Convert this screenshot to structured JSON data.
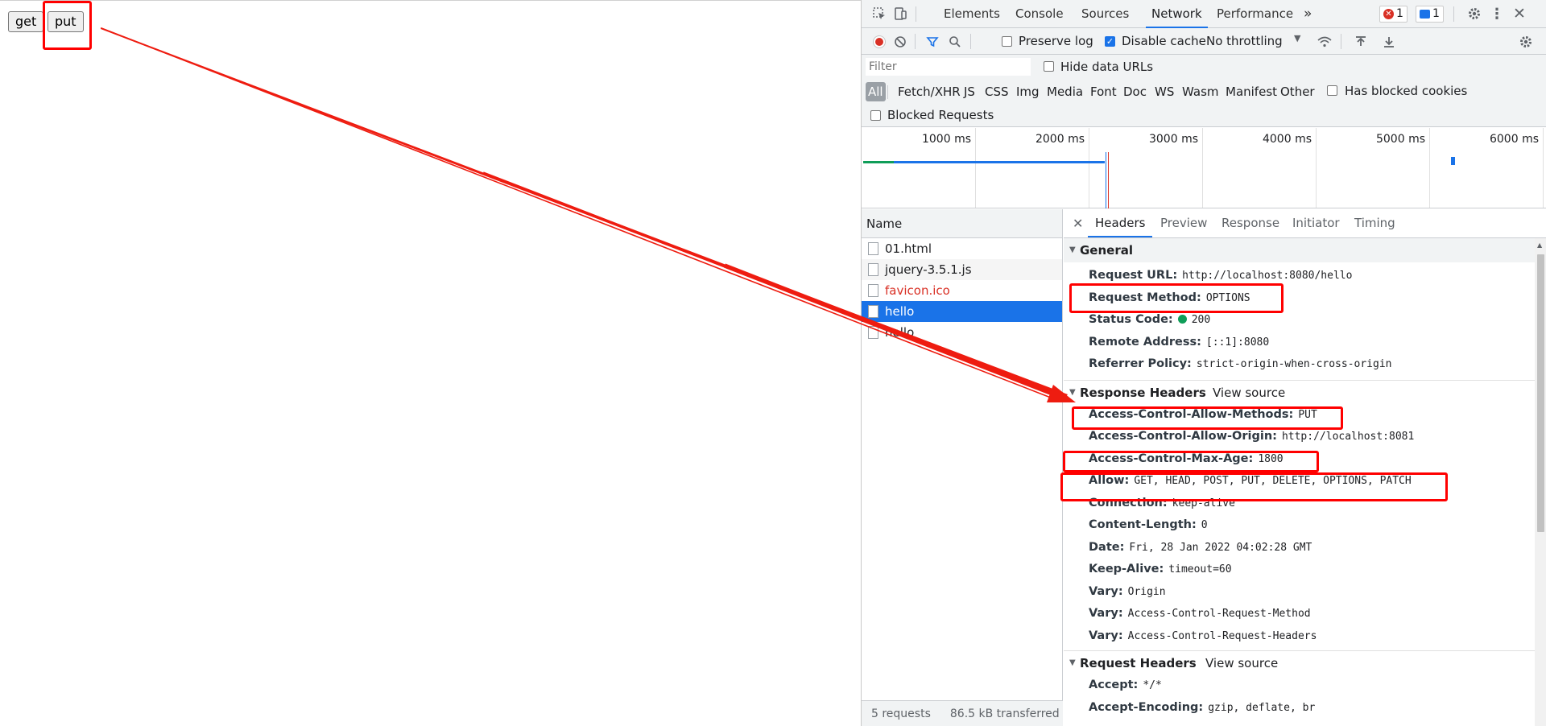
{
  "page": {
    "buttons": {
      "get_label": "get",
      "put_label": "put"
    }
  },
  "devtools": {
    "main_tabs": [
      "Elements",
      "Console",
      "Sources",
      "Network",
      "Performance"
    ],
    "more_tabs_glyph": "»",
    "errors_count": "1",
    "messages_count": "1",
    "icons": [
      "inspect-icon",
      "device-toolbar-icon",
      "settings-icon",
      "more-icon",
      "close-icon"
    ],
    "toolbar": {
      "preserve_log": "Preserve log",
      "disable_cache": "Disable cache",
      "throttling": "No throttling"
    },
    "filter": {
      "placeholder": "Filter",
      "hide_data_urls": "Hide data URLs",
      "types": [
        "All",
        "Fetch/XHR",
        "JS",
        "CSS",
        "Img",
        "Media",
        "Font",
        "Doc",
        "WS",
        "Wasm",
        "Manifest",
        "Other"
      ],
      "has_blocked_cookies": "Has blocked cookies",
      "blocked_requests": "Blocked Requests"
    },
    "overview": {
      "ticks": [
        "1000 ms",
        "2000 ms",
        "3000 ms",
        "4000 ms",
        "5000 ms",
        "6000 ms"
      ]
    },
    "requests": {
      "header": "Name",
      "rows": [
        "01.html",
        "jquery-3.5.1.js",
        "favicon.ico",
        "hello",
        "hello"
      ],
      "status_requests": "5 requests",
      "status_transferred": "86.5 kB transferred"
    },
    "detail_tabs": [
      "Headers",
      "Preview",
      "Response",
      "Initiator",
      "Timing"
    ],
    "general": {
      "title": "General",
      "rows": [
        {
          "k": "Request URL:",
          "v": "http://localhost:8080/hello"
        },
        {
          "k": "Request Method:",
          "v": "OPTIONS"
        },
        {
          "k": "Status Code:",
          "v": "200"
        },
        {
          "k": "Remote Address:",
          "v": "[::1]:8080"
        },
        {
          "k": "Referrer Policy:",
          "v": "strict-origin-when-cross-origin"
        }
      ]
    },
    "response_headers": {
      "title": "Response Headers",
      "view_source": "View source",
      "rows": [
        {
          "k": "Access-Control-Allow-Methods:",
          "v": "PUT"
        },
        {
          "k": "Access-Control-Allow-Origin:",
          "v": "http://localhost:8081"
        },
        {
          "k": "Access-Control-Max-Age:",
          "v": "1800"
        },
        {
          "k": "Allow:",
          "v": "GET, HEAD, POST, PUT, DELETE, OPTIONS, PATCH"
        },
        {
          "k": "Connection:",
          "v": "keep-alive"
        },
        {
          "k": "Content-Length:",
          "v": "0"
        },
        {
          "k": "Date:",
          "v": "Fri, 28 Jan 2022 04:02:28 GMT"
        },
        {
          "k": "Keep-Alive:",
          "v": "timeout=60"
        },
        {
          "k": "Vary:",
          "v": "Origin"
        },
        {
          "k": "Vary:",
          "v": "Access-Control-Request-Method"
        },
        {
          "k": "Vary:",
          "v": "Access-Control-Request-Headers"
        }
      ]
    },
    "request_headers": {
      "title": "Request Headers",
      "view_source": "View source",
      "rows": [
        {
          "k": "Accept:",
          "v": "*/*"
        },
        {
          "k": "Accept-Encoding:",
          "v": "gzip, deflate, br"
        }
      ]
    }
  },
  "colors": {
    "annotation": "#ff0000",
    "accent": "#1a73e8"
  }
}
